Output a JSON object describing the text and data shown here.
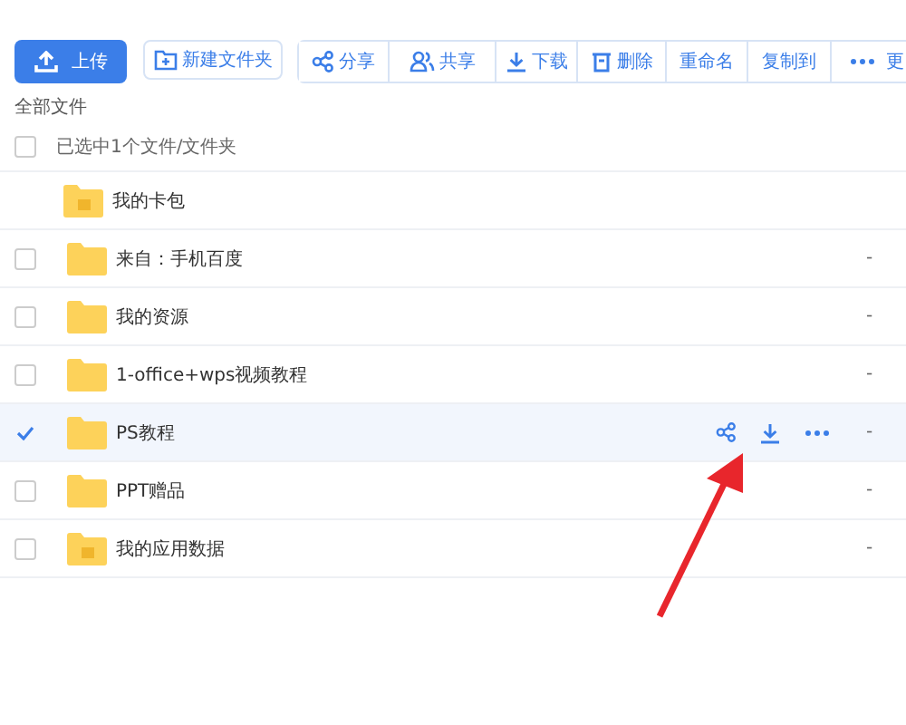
{
  "toolbar": [
    {
      "kind": "upload",
      "label": "上传"
    },
    {
      "kind": "new-folder",
      "label": "新建文件夹"
    },
    {
      "kind": "share",
      "label": "分享"
    },
    {
      "kind": "collab",
      "label": "共享"
    },
    {
      "kind": "download",
      "label": "下载"
    },
    {
      "kind": "delete",
      "label": "删除"
    },
    {
      "kind": "text",
      "label": "重命名"
    },
    {
      "kind": "text",
      "label": "复制到"
    },
    {
      "kind": "more",
      "label": "更"
    }
  ],
  "breadcrumb": "全部文件",
  "header": {
    "label": "已选中1个文件/文件夹",
    "checked": false
  },
  "rows": [
    {
      "name": "我的卡包",
      "kind": "special",
      "selectable": false,
      "selected": false
    },
    {
      "name": "来自：手机百度",
      "kind": "plain",
      "selectable": true,
      "selected": false,
      "size": "-"
    },
    {
      "name": "我的资源",
      "kind": "plain",
      "selectable": true,
      "selected": false,
      "size": "-"
    },
    {
      "name": "1-office+wps视频教程",
      "kind": "plain",
      "selectable": true,
      "selected": false,
      "size": "-"
    },
    {
      "name": "PS教程",
      "kind": "plain",
      "selectable": true,
      "selected": true,
      "size": "-"
    },
    {
      "name": "PPT赠品",
      "kind": "plain",
      "selectable": true,
      "selected": false,
      "size": "-"
    },
    {
      "name": "我的应用数据",
      "kind": "special",
      "selectable": true,
      "selected": false,
      "size": "-"
    }
  ],
  "annotation": {
    "kind": "arrow"
  }
}
